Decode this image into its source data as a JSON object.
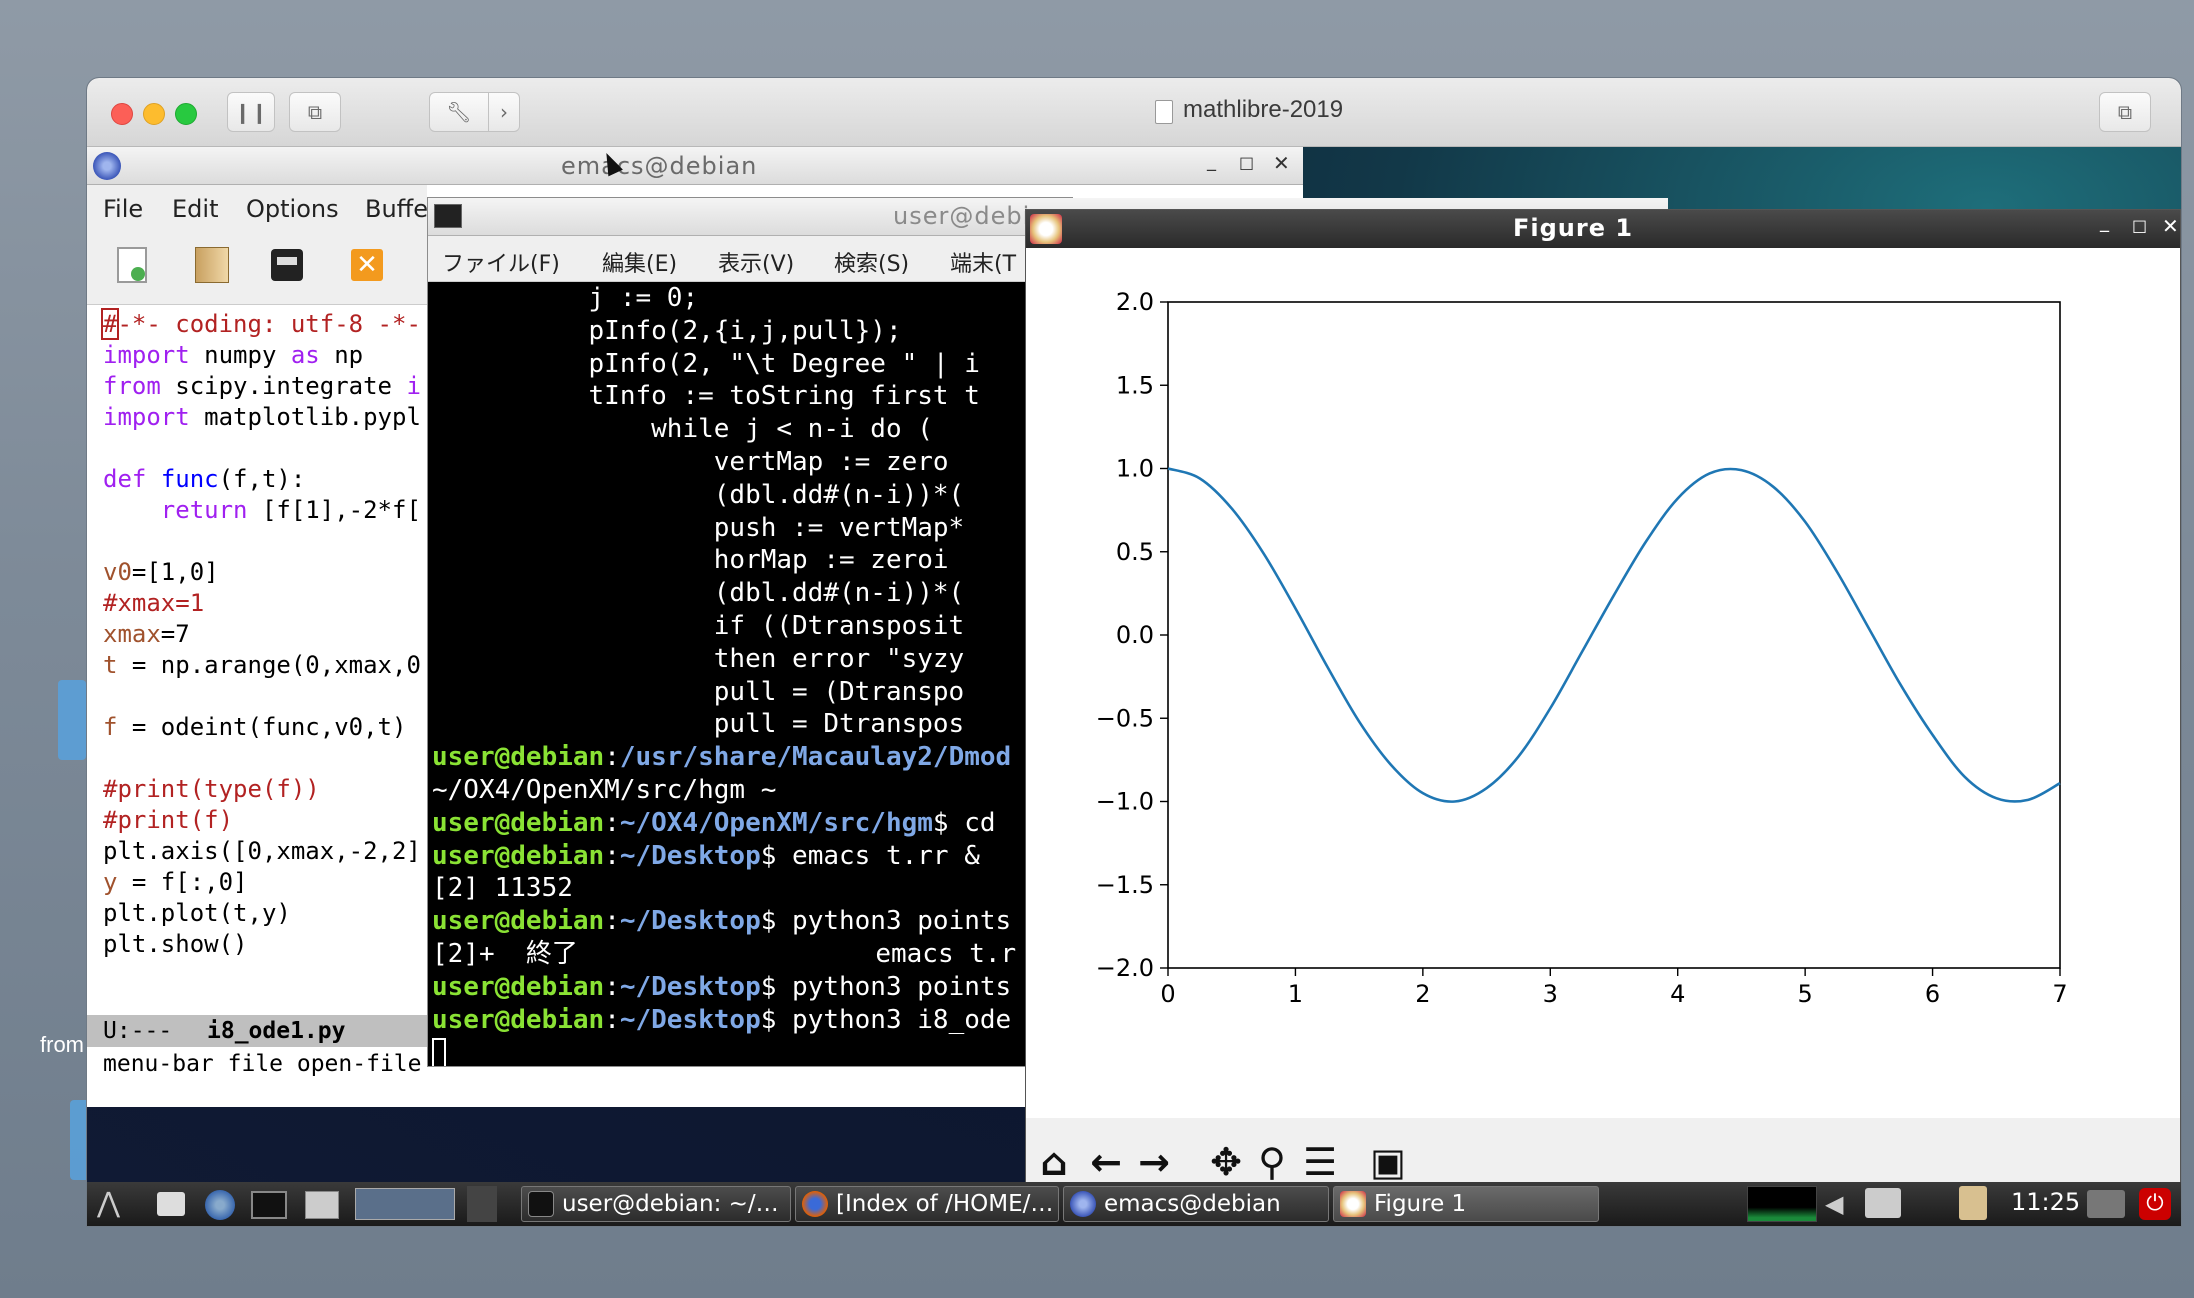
{
  "host": {
    "title": "mathlibre-2019"
  },
  "desktop": {
    "side_label": "from"
  },
  "emacs": {
    "title": "emacs@debian",
    "menu": [
      "File",
      "Edit",
      "Options",
      "Buffe"
    ],
    "code": [
      {
        "parts": [
          {
            "t": "#",
            "c": "#b22222",
            "box": true
          },
          {
            "t": "-*- coding: utf-8 -*-",
            "c": "#b22222"
          }
        ]
      },
      {
        "parts": [
          {
            "t": "import",
            "c": "#a020f0"
          },
          {
            "t": " numpy ",
            "c": "#000"
          },
          {
            "t": "as",
            "c": "#a020f0"
          },
          {
            "t": " np",
            "c": "#000"
          }
        ]
      },
      {
        "parts": [
          {
            "t": "from",
            "c": "#a020f0"
          },
          {
            "t": " scipy.integrate ",
            "c": "#000"
          },
          {
            "t": "i",
            "c": "#a020f0"
          }
        ]
      },
      {
        "parts": [
          {
            "t": "import",
            "c": "#a020f0"
          },
          {
            "t": " matplotlib.pypl",
            "c": "#000"
          }
        ]
      },
      {
        "parts": []
      },
      {
        "parts": [
          {
            "t": "def",
            "c": "#a020f0"
          },
          {
            "t": " ",
            "c": "#000"
          },
          {
            "t": "func",
            "c": "#0000ff"
          },
          {
            "t": "(f,t):",
            "c": "#000"
          }
        ]
      },
      {
        "parts": [
          {
            "t": "    ",
            "c": "#000"
          },
          {
            "t": "return",
            "c": "#a020f0"
          },
          {
            "t": " [f[1],-2*f[",
            "c": "#000"
          }
        ]
      },
      {
        "parts": []
      },
      {
        "parts": [
          {
            "t": "v0",
            "c": "#a0522d"
          },
          {
            "t": "=[1,0]",
            "c": "#000"
          }
        ]
      },
      {
        "parts": [
          {
            "t": "#xmax=1",
            "c": "#b22222"
          }
        ]
      },
      {
        "parts": [
          {
            "t": "xmax",
            "c": "#a0522d"
          },
          {
            "t": "=7",
            "c": "#000"
          }
        ]
      },
      {
        "parts": [
          {
            "t": "t",
            "c": "#a0522d"
          },
          {
            "t": " = np.arange(0,xmax,0",
            "c": "#000"
          }
        ]
      },
      {
        "parts": []
      },
      {
        "parts": [
          {
            "t": "f",
            "c": "#a0522d"
          },
          {
            "t": " = odeint(func,v0,t)",
            "c": "#000"
          }
        ]
      },
      {
        "parts": []
      },
      {
        "parts": [
          {
            "t": "#print(type(f))",
            "c": "#b22222"
          }
        ]
      },
      {
        "parts": [
          {
            "t": "#print(f)",
            "c": "#b22222"
          }
        ]
      },
      {
        "parts": [
          {
            "t": "plt.axis([0,xmax,-2,2]",
            "c": "#000"
          }
        ]
      },
      {
        "parts": [
          {
            "t": "y",
            "c": "#a0522d"
          },
          {
            "t": " = f[:,0]",
            "c": "#000"
          }
        ]
      },
      {
        "parts": [
          {
            "t": "plt.plot(t,y)",
            "c": "#000"
          }
        ]
      },
      {
        "parts": [
          {
            "t": "plt.show()",
            "c": "#000"
          }
        ]
      }
    ],
    "modeline_status": "U:---",
    "modeline_file": "i8_ode1.py",
    "minibuffer": "menu-bar file open-file"
  },
  "terminal": {
    "title": "user@debi",
    "menu": [
      "ファイル(F)",
      "編集(E)",
      "表示(V)",
      "検索(S)",
      "端末(T"
    ],
    "lines": [
      [
        {
          "t": "          j := 0;"
        }
      ],
      [
        {
          "t": "          pInfo(2,{i,j,pull});"
        }
      ],
      [
        {
          "t": "          pInfo(2, \"\\t Degree \" | i"
        }
      ],
      [
        {
          "t": "          tInfo := toString first t"
        }
      ],
      [
        {
          "t": "              while j < n-i do ("
        }
      ],
      [
        {
          "t": "                  vertMap := zero"
        }
      ],
      [
        {
          "t": "                  (dbl.dd#(n-i))*("
        }
      ],
      [
        {
          "t": "                  push := vertMap*"
        }
      ],
      [
        {
          "t": "                  horMap := zeroi"
        }
      ],
      [
        {
          "t": "                  (dbl.dd#(n-i))*("
        }
      ],
      [
        {
          "t": "                  if ((Dtransposit"
        }
      ],
      [
        {
          "t": "                  then error \"syzy"
        }
      ],
      [
        {
          "t": "                  pull = (Dtranspo"
        }
      ],
      [
        {
          "t": "                  pull = Dtranspos"
        }
      ],
      [
        {
          "t": "user@debian",
          "k": "g"
        },
        {
          "t": ":"
        },
        {
          "t": "/usr/share/Macaulay2/Dmod",
          "k": "b"
        }
      ],
      [
        {
          "t": "~/OX4/OpenXM/src/hgm ~"
        }
      ],
      [
        {
          "t": "user@debian",
          "k": "g"
        },
        {
          "t": ":"
        },
        {
          "t": "~/OX4/OpenXM/src/hgm",
          "k": "b"
        },
        {
          "t": "$ cd"
        }
      ],
      [
        {
          "t": "user@debian",
          "k": "g"
        },
        {
          "t": ":"
        },
        {
          "t": "~/Desktop",
          "k": "b"
        },
        {
          "t": "$ emacs t.rr &"
        }
      ],
      [
        {
          "t": "[2] 11352"
        }
      ],
      [
        {
          "t": "user@debian",
          "k": "g"
        },
        {
          "t": ":"
        },
        {
          "t": "~/Desktop",
          "k": "b"
        },
        {
          "t": "$ python3 points"
        }
      ],
      [
        {
          "t": "[2]+  終了                   emacs t.r"
        }
      ],
      [
        {
          "t": "user@debian",
          "k": "g"
        },
        {
          "t": ":"
        },
        {
          "t": "~/Desktop",
          "k": "b"
        },
        {
          "t": "$ python3 points"
        }
      ],
      [
        {
          "t": "user@debian",
          "k": "g"
        },
        {
          "t": ":"
        },
        {
          "t": "~/Desktop",
          "k": "b"
        },
        {
          "t": "$ python3 i8_ode"
        }
      ]
    ]
  },
  "figure": {
    "title": "Figure 1",
    "toolbar": [
      "home-icon",
      "back-arrow-icon",
      "forward-arrow-icon",
      "pan-icon",
      "zoom-icon",
      "configure-subplots-icon",
      "save-icon"
    ]
  },
  "chart_data": {
    "type": "line",
    "title": "",
    "xlabel": "",
    "ylabel": "",
    "xlim": [
      0,
      7
    ],
    "ylim": [
      -2,
      2
    ],
    "xticks": [
      "0",
      "1",
      "2",
      "3",
      "4",
      "5",
      "6",
      "7"
    ],
    "yticks": [
      "2.0",
      "1.5",
      "1.0",
      "0.5",
      "0.0",
      "−0.5",
      "−1.0",
      "−1.5",
      "−2.0"
    ],
    "series": [
      {
        "color": "#1f77b4",
        "x": [
          0,
          0.25,
          0.5,
          0.75,
          1.0,
          1.25,
          1.5,
          1.75,
          2.0,
          2.25,
          2.5,
          2.75,
          3.0,
          3.25,
          3.5,
          3.75,
          4.0,
          4.25,
          4.5,
          4.75,
          5.0,
          5.25,
          5.5,
          5.75,
          6.0,
          6.25,
          6.5,
          6.75,
          7.0
        ],
        "y": [
          1.0,
          0.94,
          0.76,
          0.49,
          0.16,
          -0.19,
          -0.52,
          -0.78,
          -0.95,
          -1.0,
          -0.92,
          -0.73,
          -0.44,
          -0.1,
          0.24,
          0.56,
          0.82,
          0.97,
          0.99,
          0.89,
          0.68,
          0.38,
          0.04,
          -0.3,
          -0.6,
          -0.85,
          -0.98,
          -0.99,
          -0.89
        ]
      }
    ],
    "grid": false
  },
  "taskbar": {
    "tasks": [
      "user@debian: ~/…",
      "[Index of /HOME/…",
      "emacs@debian",
      "Figure 1"
    ],
    "clock": "11:25"
  }
}
